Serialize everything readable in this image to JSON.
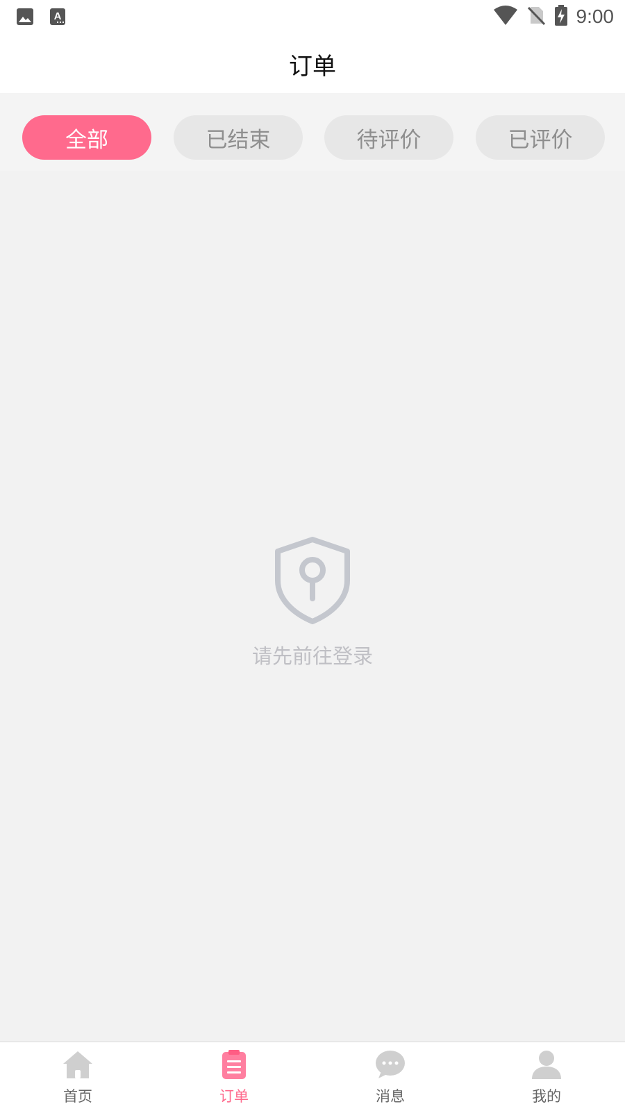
{
  "status_bar": {
    "time": "9:00",
    "icons": [
      "image-icon",
      "font-a-icon",
      "wifi-icon",
      "no-sim-icon",
      "battery-charging-icon"
    ]
  },
  "header": {
    "title": "订单"
  },
  "tabs": [
    {
      "label": "全部",
      "active": true
    },
    {
      "label": "已结束",
      "active": false
    },
    {
      "label": "待评价",
      "active": false
    },
    {
      "label": "已评价",
      "active": false
    }
  ],
  "empty_state": {
    "icon": "shield-keyhole-icon",
    "message": "请先前往登录"
  },
  "bottom_nav": [
    {
      "label": "首页",
      "icon": "home-icon",
      "active": false
    },
    {
      "label": "订单",
      "icon": "order-list-icon",
      "active": true
    },
    {
      "label": "消息",
      "icon": "chat-bubble-icon",
      "active": false
    },
    {
      "label": "我的",
      "icon": "person-icon",
      "active": false
    }
  ],
  "colors": {
    "accent": "#ff6a8d",
    "tab_inactive_bg": "#e7e7e7",
    "tab_inactive_text": "#8e8e8e",
    "content_bg": "#f2f2f2",
    "empty_icon": "#c4c7ce",
    "nav_inactive_icon": "#cfcfcf"
  }
}
